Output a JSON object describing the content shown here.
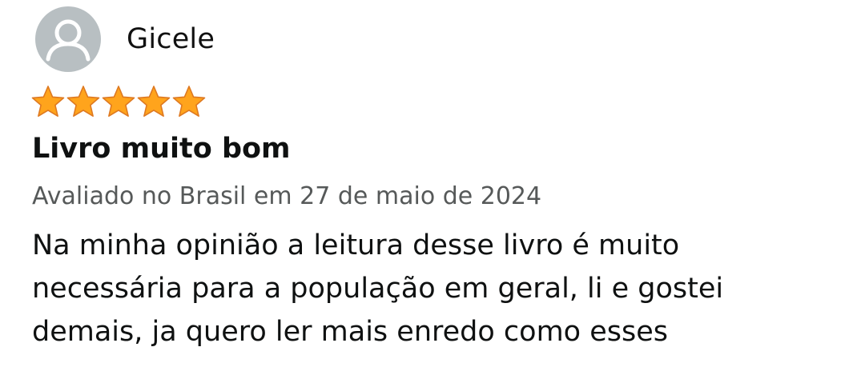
{
  "review": {
    "reviewer_name": "Gicele",
    "avatar_icon": "user-silhouette-icon",
    "rating": 5,
    "rating_max": 5,
    "star_color": "#FFA41C",
    "star_outline_color": "#DE7921",
    "title": "Livro muito bom",
    "date_text": "Avaliado no Brasil em 27 de maio de 2024",
    "body_lines": [
      "Na minha opinião a leitura desse livro é muito",
      "necessária para a população em geral, li e gostei",
      "demais, ja quero ler mais enredo como esses"
    ]
  }
}
